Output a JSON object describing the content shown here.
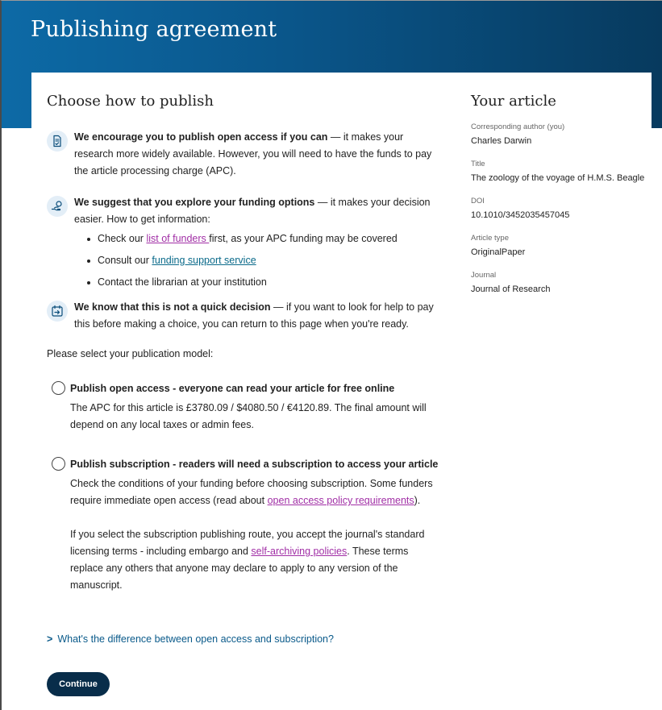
{
  "page": {
    "title": "Publishing agreement"
  },
  "main": {
    "heading": "Choose how to publish",
    "info_blocks": [
      {
        "icon": "document-check-icon",
        "bold": "We encourage you to publish open access if you can",
        "text": " — it makes your research more widely available. However, you will need to have the funds to pay the article processing charge (APC)."
      },
      {
        "icon": "hand-coin-icon",
        "bold": "We suggest that you explore your funding options",
        "text": " — it makes your decision easier. How to get information:",
        "bullets": [
          {
            "prefix": "Check our ",
            "link": "list of funders ",
            "suffix": "first, as your APC funding may be covered"
          },
          {
            "prefix": "Consult our ",
            "link": "funding support service",
            "suffix": ""
          },
          {
            "prefix": "Contact the librarian at your institution",
            "link": "",
            "suffix": ""
          }
        ]
      },
      {
        "icon": "calendar-arrow-icon",
        "bold": "We know that this is not a quick decision",
        "text": " — if you want to look for help to pay this before making a choice, you can return to this page when you're ready."
      }
    ],
    "prompt": "Please select your publication model:",
    "options": [
      {
        "title": "Publish open access - everyone can read your article for free online",
        "body": "The APC for this article is £3780.09 / $4080.50 / €4120.89. The final amount will depend on any local taxes or admin fees."
      },
      {
        "title": "Publish subscription - readers will need a subscription to access your article",
        "body1_prefix": "Check the conditions of your funding before choosing subscription. Some funders require immediate open access (read about ",
        "body1_link": "open access policy requirements",
        "body1_suffix": ").",
        "body2_prefix": "If you select the subscription publishing route, you accept the journal's standard licensing terms - including embargo and ",
        "body2_link": "self-archiving policies",
        "body2_suffix": ". These terms replace any others that anyone may declare to apply to any version of the manuscript."
      }
    ],
    "disclosure": "What's the difference between open access and subscription?",
    "continue_label": "Continue"
  },
  "sidebar": {
    "heading": "Your article",
    "fields": [
      {
        "label": "Corresponding author (you)",
        "value": "Charles Darwin"
      },
      {
        "label": "Title",
        "value": "The zoology of the voyage of H.M.S. Beagle"
      },
      {
        "label": "DOI",
        "value": "10.1010/3452035457045"
      },
      {
        "label": "Article type",
        "value": "OriginalPaper"
      },
      {
        "label": "Journal",
        "value": "Journal of Research"
      }
    ]
  },
  "colors": {
    "hero_start": "#0d6aa6",
    "hero_end": "#073a5e",
    "button": "#082d4a",
    "link_purple": "#a12fa6",
    "link_teal": "#0a6a8a",
    "icon_bg": "#e3eef7"
  }
}
